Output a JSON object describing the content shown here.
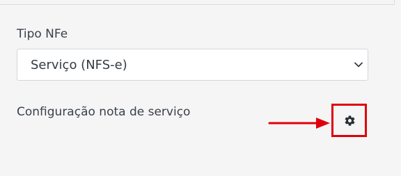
{
  "form": {
    "tipo_nfe_label": "Tipo NFe",
    "tipo_nfe_value": "Serviço (NFS-e)",
    "config_label": "Configuração nota de serviço"
  },
  "icons": {
    "select_caret": "chevron-down-icon",
    "settings": "gear-icon",
    "annotation": "arrow-right-icon"
  },
  "colors": {
    "annotation_red": "#e0000b",
    "gear": "#2b2f33"
  }
}
